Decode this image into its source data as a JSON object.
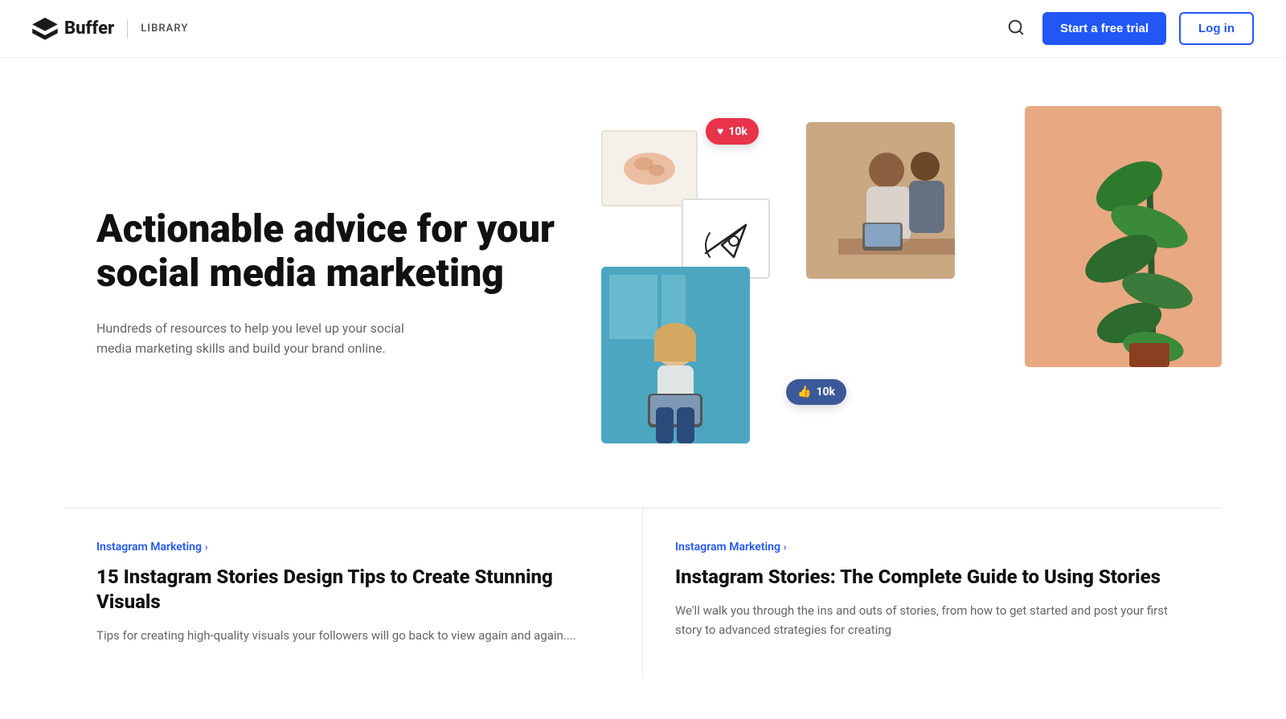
{
  "header": {
    "logo_text": "Buffer",
    "library_label": "LIBRARY",
    "start_trial_label": "Start a free trial",
    "login_label": "Log in"
  },
  "hero": {
    "title": "Actionable advice for your social media marketing",
    "subtitle": "Hundreds of resources to help you level up your social media marketing skills and build your brand online.",
    "like_badge_red": "10k",
    "like_badge_blue": "10k"
  },
  "articles": [
    {
      "category": "Instagram Marketing",
      "title": "15 Instagram Stories Design Tips to Create Stunning Visuals",
      "excerpt": "Tips for creating high-quality visuals your followers will go back to view again and again...."
    },
    {
      "category": "Instagram Marketing",
      "title": "Instagram Stories: The Complete Guide to Using Stories",
      "excerpt": "We'll walk you through the ins and outs of stories, from how to get started and post your first story to advanced strategies for creating"
    }
  ]
}
